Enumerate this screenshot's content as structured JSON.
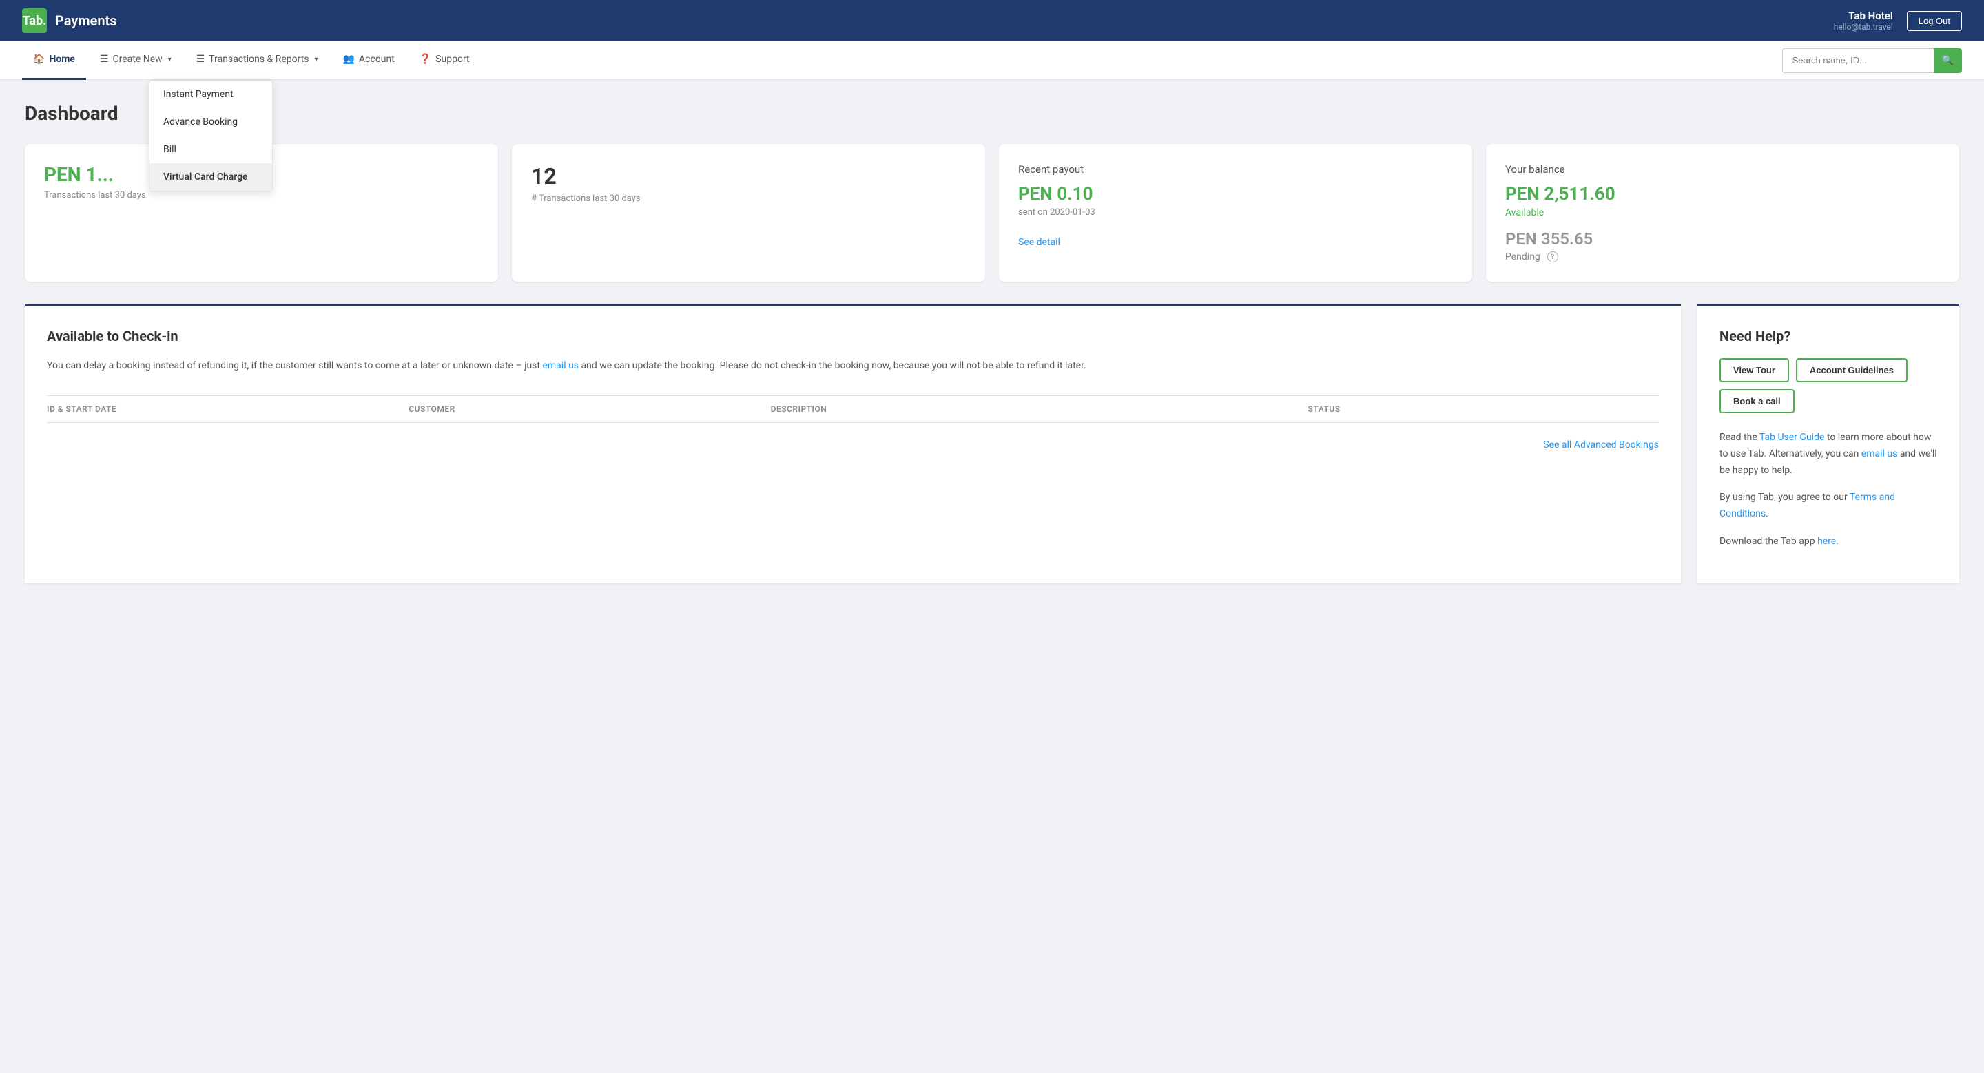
{
  "app": {
    "logo_text": "Tab.",
    "title": "Payments"
  },
  "header": {
    "hotel_name": "Tab Hotel",
    "hotel_email": "hello@tab.travel",
    "logout_label": "Log Out"
  },
  "nav": {
    "items": [
      {
        "id": "home",
        "label": "Home",
        "icon": "🏠",
        "active": true
      },
      {
        "id": "create-new",
        "label": "Create New",
        "icon": "☰",
        "has_dropdown": true
      },
      {
        "id": "transactions",
        "label": "Transactions & Reports",
        "icon": "☰",
        "has_dropdown": true
      },
      {
        "id": "account",
        "label": "Account",
        "icon": "👥",
        "has_dropdown": false
      },
      {
        "id": "support",
        "label": "Support",
        "icon": "❓",
        "has_dropdown": false
      }
    ],
    "search_placeholder": "Search name, ID..."
  },
  "dropdown": {
    "items": [
      {
        "id": "instant-payment",
        "label": "Instant Payment",
        "highlighted": false
      },
      {
        "id": "advance-booking",
        "label": "Advance Booking",
        "highlighted": false
      },
      {
        "id": "bill",
        "label": "Bill",
        "highlighted": false
      },
      {
        "id": "virtual-card-charge",
        "label": "Virtual Card Charge",
        "highlighted": true
      }
    ]
  },
  "dashboard": {
    "title": "Dashboard",
    "cards": [
      {
        "id": "transactions-count",
        "label": "PEN 1...",
        "sub_label": "Transactions last 30 days",
        "type": "obscured"
      },
      {
        "id": "transactions-number",
        "value": "12",
        "label": "# Transactions last 30 days",
        "type": "count"
      },
      {
        "id": "recent-payout",
        "title": "Recent payout",
        "value": "PEN 0.10",
        "sub": "sent on 2020-01-03",
        "link": "See detail",
        "type": "payout"
      },
      {
        "id": "your-balance",
        "title": "Your balance",
        "available_value": "PEN 2,511.60",
        "available_label": "Available",
        "pending_value": "PEN 355.65",
        "pending_label": "Pending",
        "type": "balance"
      }
    ]
  },
  "checkin_section": {
    "title": "Available to Check-in",
    "description_parts": [
      "You can delay a booking instead of refunding it, if the customer still wants to come at a later or unknown date – just ",
      "email us",
      " and we can update the booking. Please do not check-in the booking now, because you will not be able to refund it later."
    ],
    "email_link": "email us",
    "columns": [
      "ID & START DATE",
      "CUSTOMER",
      "DESCRIPTION",
      "STATUS"
    ],
    "see_all_label": "See all Advanced Bookings"
  },
  "help_section": {
    "title": "Need Help?",
    "buttons": [
      {
        "id": "view-tour",
        "label": "View Tour"
      },
      {
        "id": "account-guidelines",
        "label": "Account Guidelines"
      },
      {
        "id": "book-call",
        "label": "Book a call"
      }
    ],
    "text_parts": [
      "Read the ",
      "Tab User Guide",
      " to learn more about how to use Tab. Alternatively, you can ",
      "email us",
      " and we'll be happy to help."
    ],
    "terms_parts": [
      "By using Tab, you agree to our ",
      "Terms and Conditions",
      "."
    ],
    "app_parts": [
      "Download the Tab app ",
      "here",
      "."
    ]
  }
}
